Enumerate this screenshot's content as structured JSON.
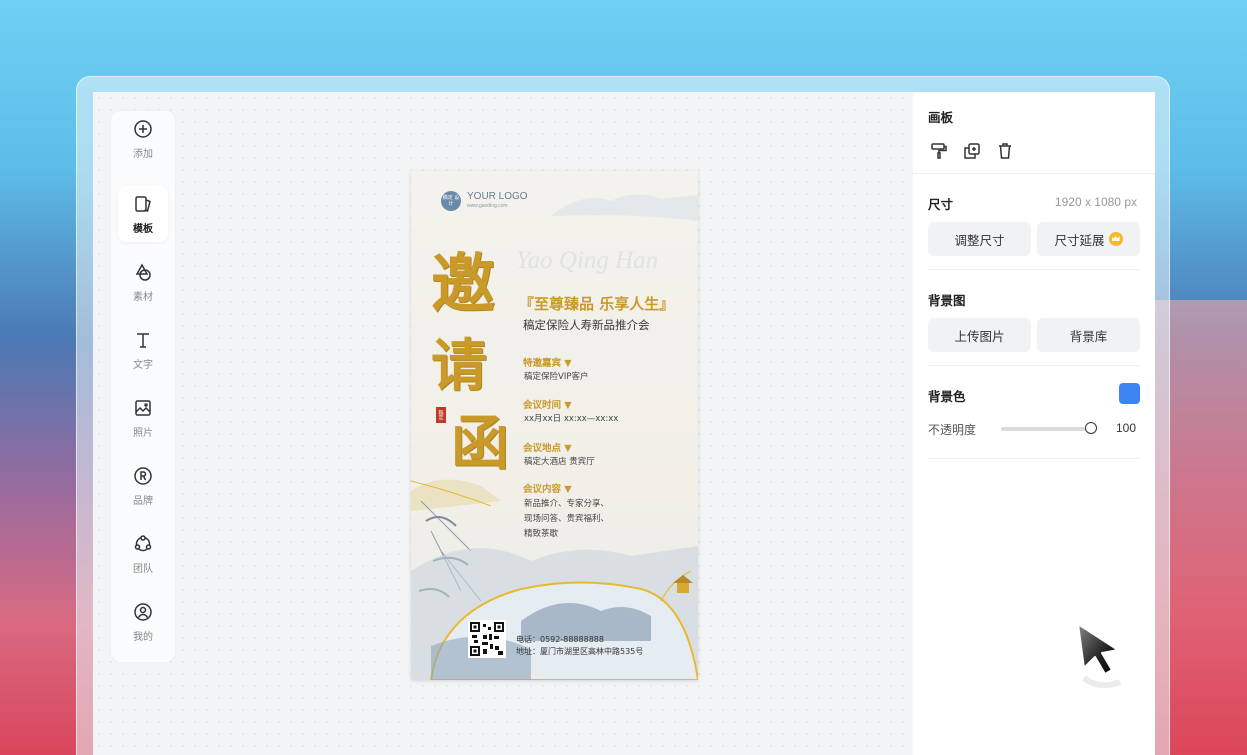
{
  "toolbar": {
    "items": [
      {
        "label": "添加",
        "icon": "plus-circle-icon"
      },
      {
        "label": "模板",
        "icon": "template-icon",
        "active": true
      },
      {
        "label": "素材",
        "icon": "shapes-icon"
      },
      {
        "label": "文字",
        "icon": "text-icon"
      },
      {
        "label": "照片",
        "icon": "image-icon"
      },
      {
        "label": "品牌",
        "icon": "registered-icon"
      },
      {
        "label": "团队",
        "icon": "team-icon"
      },
      {
        "label": "我的",
        "icon": "user-icon"
      }
    ]
  },
  "poster": {
    "logo_badge": "稿定\n设计",
    "logo_text": "YOUR LOGO",
    "logo_url": "www.gaoding.com",
    "en_title": "Yao Qing Han",
    "big_chars": [
      "邀",
      "请",
      "函"
    ],
    "seal": "稿定",
    "slogan": "『至尊臻品  乐享人生』",
    "subtitle": "稿定保险人寿新品推介会",
    "sections": [
      {
        "title": "特邀嘉宾 ▼",
        "body": [
          "稿定保险VIP客户"
        ]
      },
      {
        "title": "会议时间 ▼",
        "body": [
          "xx月xx日  xx:xx—xx:xx"
        ]
      },
      {
        "title": "会议地点 ▼",
        "body": [
          "稿定大酒店 贵宾厅"
        ]
      },
      {
        "title": "会议内容 ▼",
        "body": [
          "新品推介、专家分享、",
          "现场问答、贵宾福利、",
          "精致茶歇"
        ]
      }
    ],
    "phone": "电话：0592-88888888",
    "address": "地址：厦门市湖里区高林中路535号"
  },
  "panel": {
    "title": "画板",
    "size_label": "尺寸",
    "size_value": "1920 x 1080 px",
    "resize_btn": "调整尺寸",
    "extend_btn": "尺寸延展",
    "bg_image_label": "背景图",
    "upload_btn": "上传图片",
    "bg_library_btn": "背景库",
    "bg_color_label": "背景色",
    "bg_color": "#3d85f5",
    "opacity_label": "不透明度",
    "opacity_value": "100"
  }
}
